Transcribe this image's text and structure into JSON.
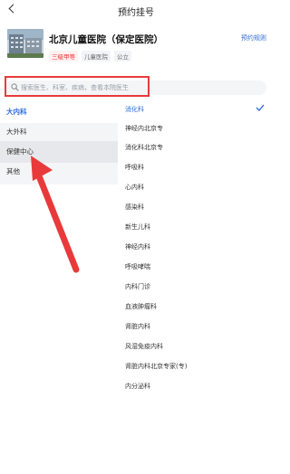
{
  "header": {
    "title": "预约挂号"
  },
  "hospital": {
    "name": "北京儿童医院（保定医院）",
    "tags": [
      "三级甲等",
      "儿童医院",
      "公立"
    ],
    "rule_link": "预约规则"
  },
  "search": {
    "placeholder": "搜索医生、科室、疾病，查看本院医生"
  },
  "left_menu": [
    {
      "label": "大内科",
      "state": "active"
    },
    {
      "label": "大外科",
      "state": "normal"
    },
    {
      "label": "保健中心",
      "state": "highlight"
    },
    {
      "label": "其他",
      "state": "normal"
    }
  ],
  "right_menu": [
    "消化科",
    "神经内北京专",
    "消化科北京专",
    "呼吸科",
    "心内科",
    "感染科",
    "新生儿科",
    "神经内科",
    "呼吸哮喘",
    "内科门诊",
    "血液肿瘤科",
    "肾脏内科",
    "风湿免疫内科",
    "肾脏内科北京专家(专)",
    "内分泌科"
  ],
  "colors": {
    "accent": "#2f6bd8",
    "annotation": "#e83a3a"
  }
}
